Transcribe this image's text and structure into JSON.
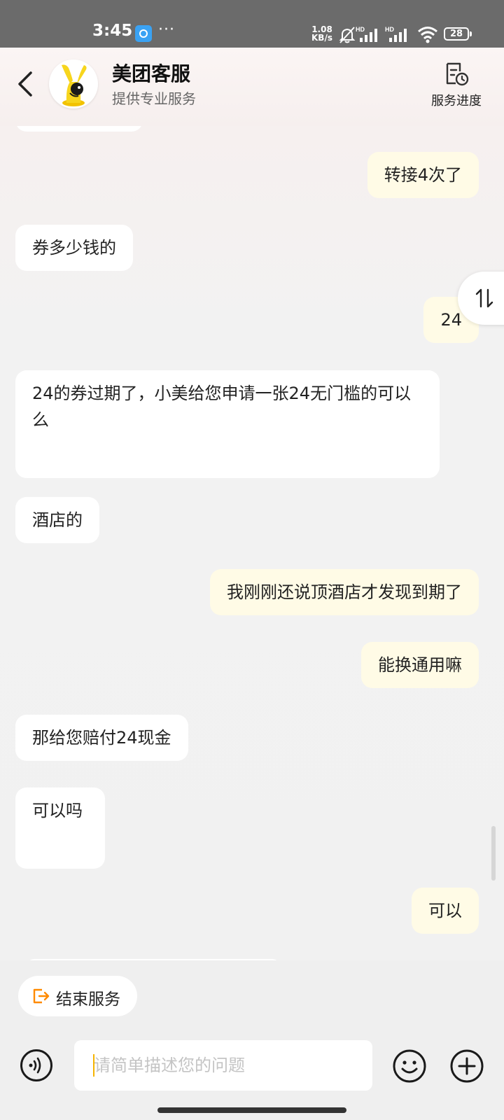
{
  "status_bar": {
    "time": "3:45",
    "dots": "···",
    "net_speed_value": "1.08",
    "net_speed_unit": "KB/s",
    "battery": "28",
    "signal_label": "HD"
  },
  "header": {
    "title": "美团客服",
    "subtitle": "提供专业服务",
    "progress_label": "服务进度",
    "brand_color": "#f7d51d"
  },
  "messages": [
    {
      "side": "out",
      "text": "转接4次了"
    },
    {
      "side": "in",
      "text": "券多少钱的"
    },
    {
      "side": "out",
      "text": "24"
    },
    {
      "side": "in",
      "text": "24的券过期了，小美给您申请一张24无门槛的可以么"
    },
    {
      "side": "in",
      "text": "酒店的"
    },
    {
      "side": "out",
      "text": "我刚刚还说顶酒店才发现到期了"
    },
    {
      "side": "out",
      "text": "能换通用嘛"
    },
    {
      "side": "in",
      "text": "那给您赔付24现金"
    },
    {
      "side": "in",
      "text": "可以吗"
    },
    {
      "side": "out",
      "text": "可以"
    }
  ],
  "bottom": {
    "end_service_label": "结束服务",
    "input_placeholder": "请简单描述您的问题",
    "accent_color": "#ff8a00"
  },
  "icons": [
    "back-arrow-icon",
    "service-progress-icon",
    "swap-sort-icon",
    "end-service-icon",
    "voice-icon",
    "emoji-icon",
    "plus-icon"
  ]
}
